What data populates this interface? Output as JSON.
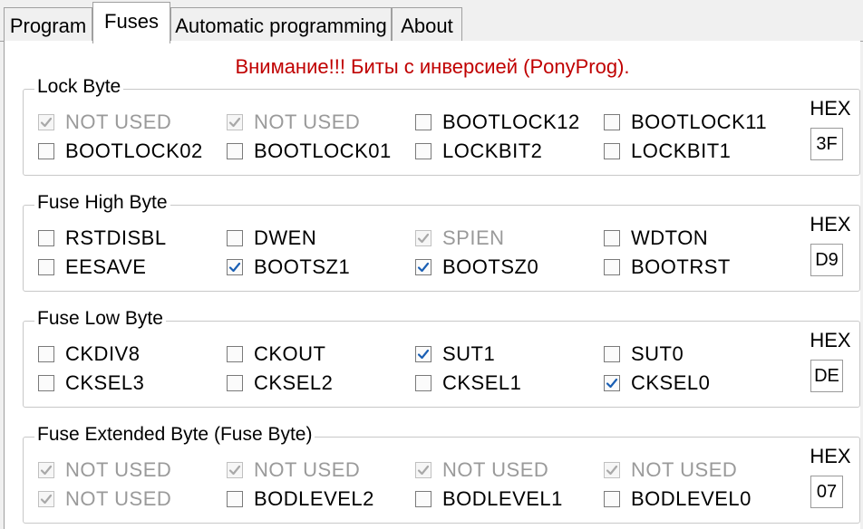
{
  "tabs": [
    "Program",
    "Fuses",
    "Automatic programming",
    "About"
  ],
  "warning": "Внимание!!! Биты с инверсией (PonyProg).",
  "hex_label": "HEX",
  "groups": [
    {
      "title": "Lock Byte",
      "hex": "3F",
      "bits": [
        {
          "label": "NOT USED",
          "checked": true,
          "disabled": true
        },
        {
          "label": "NOT USED",
          "checked": true,
          "disabled": true
        },
        {
          "label": "BOOTLOCK12",
          "checked": false,
          "disabled": false
        },
        {
          "label": "BOOTLOCK11",
          "checked": false,
          "disabled": false
        },
        {
          "label": "BOOTLOCK02",
          "checked": false,
          "disabled": false
        },
        {
          "label": "BOOTLOCK01",
          "checked": false,
          "disabled": false
        },
        {
          "label": "LOCKBIT2",
          "checked": false,
          "disabled": false
        },
        {
          "label": "LOCKBIT1",
          "checked": false,
          "disabled": false
        }
      ]
    },
    {
      "title": "Fuse High Byte",
      "hex": "D9",
      "bits": [
        {
          "label": "RSTDISBL",
          "checked": false,
          "disabled": false
        },
        {
          "label": "DWEN",
          "checked": false,
          "disabled": false
        },
        {
          "label": "SPIEN",
          "checked": true,
          "disabled": true
        },
        {
          "label": "WDTON",
          "checked": false,
          "disabled": false
        },
        {
          "label": "EESAVE",
          "checked": false,
          "disabled": false
        },
        {
          "label": "BOOTSZ1",
          "checked": true,
          "disabled": false
        },
        {
          "label": "BOOTSZ0",
          "checked": true,
          "disabled": false
        },
        {
          "label": "BOOTRST",
          "checked": false,
          "disabled": false
        }
      ]
    },
    {
      "title": "Fuse Low Byte",
      "hex": "DE",
      "bits": [
        {
          "label": "CKDIV8",
          "checked": false,
          "disabled": false
        },
        {
          "label": "CKOUT",
          "checked": false,
          "disabled": false
        },
        {
          "label": "SUT1",
          "checked": true,
          "disabled": false
        },
        {
          "label": "SUT0",
          "checked": false,
          "disabled": false
        },
        {
          "label": "CKSEL3",
          "checked": false,
          "disabled": false
        },
        {
          "label": "CKSEL2",
          "checked": false,
          "disabled": false
        },
        {
          "label": "CKSEL1",
          "checked": false,
          "disabled": false
        },
        {
          "label": "CKSEL0",
          "checked": true,
          "disabled": false
        }
      ]
    },
    {
      "title": "Fuse Extended Byte (Fuse Byte)",
      "hex": "07",
      "bits": [
        {
          "label": "NOT USED",
          "checked": true,
          "disabled": true
        },
        {
          "label": "NOT USED",
          "checked": true,
          "disabled": true
        },
        {
          "label": "NOT USED",
          "checked": true,
          "disabled": true
        },
        {
          "label": "NOT USED",
          "checked": true,
          "disabled": true
        },
        {
          "label": "NOT USED",
          "checked": true,
          "disabled": true
        },
        {
          "label": "BODLEVEL2",
          "checked": false,
          "disabled": false
        },
        {
          "label": "BODLEVEL1",
          "checked": false,
          "disabled": false
        },
        {
          "label": "BODLEVEL0",
          "checked": false,
          "disabled": false
        }
      ]
    }
  ],
  "colors": {
    "warning": "#c00000",
    "check_enabled": "#1a5fb4",
    "check_disabled": "#a8a8a8"
  }
}
